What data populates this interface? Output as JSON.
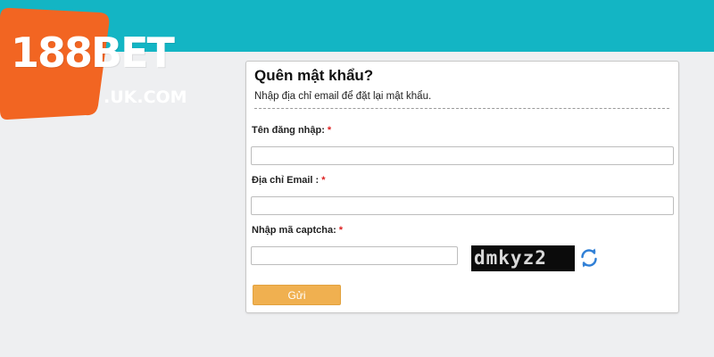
{
  "brand": {
    "logo_text": "188BET",
    "domain": ".UK.COM",
    "logo_color": "#f26522",
    "header_color": "#13b5c4"
  },
  "form": {
    "title": "Quên mật khẩu?",
    "subtitle": "Nhập địa chỉ email để đặt lại mật khẩu.",
    "username_label": "Tên đăng nhập:",
    "email_label": "Địa chỉ Email :",
    "captcha_label": "Nhập mã captcha:",
    "required_mark": "*",
    "username_value": "",
    "email_value": "",
    "captcha_value": "",
    "captcha_code": "dmkyz2",
    "refresh_icon": "refresh-icon",
    "submit_label": "Gửi",
    "submit_color": "#f0b050",
    "required_color": "#dd2222"
  }
}
